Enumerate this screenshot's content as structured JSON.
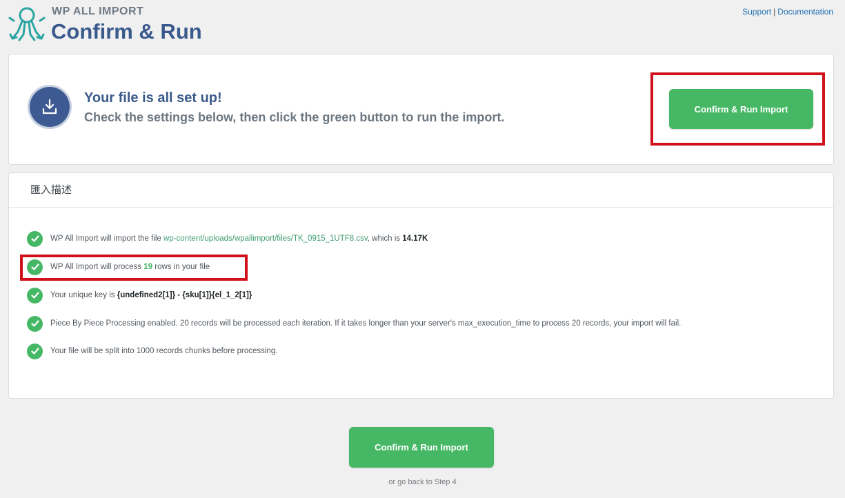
{
  "header": {
    "brand": "WP ALL IMPORT",
    "title": "Confirm & Run",
    "links": {
      "support": "Support",
      "separator": "|",
      "documentation": "Documentation"
    }
  },
  "setup": {
    "title": "Your file is all set up!",
    "subtitle": "Check the settings below, then click the green button to run the import.",
    "confirm_button": "Confirm & Run Import"
  },
  "summary": {
    "heading": "匯入描述",
    "items": {
      "file": {
        "prefix": "WP All Import will import the file ",
        "path": "wp-content/uploads/wpallimport/files/TK_0915_1UTF8.csv",
        "middle": ", which is ",
        "size": "14.17K"
      },
      "rows": {
        "prefix": "WP All Import will process ",
        "count": "19",
        "suffix": " rows in your file"
      },
      "key": {
        "prefix": "Your unique key is ",
        "value": "{undefined2[1]} - {sku[1]}{el_1_2[1]}"
      },
      "piece": "Piece By Piece Processing enabled. 20 records will be processed each iteration. If it takes longer than your server's max_execution_time to process 20 records, your import will fail.",
      "split": "Your file will be split into 1000 records chunks before processing."
    }
  },
  "footer": {
    "confirm_button": "Confirm & Run Import",
    "go_back": "or go back to Step 4"
  },
  "colors": {
    "accent_green": "#46b865",
    "brand_blue": "#3a5a8c",
    "highlight_red": "#d0101a"
  }
}
